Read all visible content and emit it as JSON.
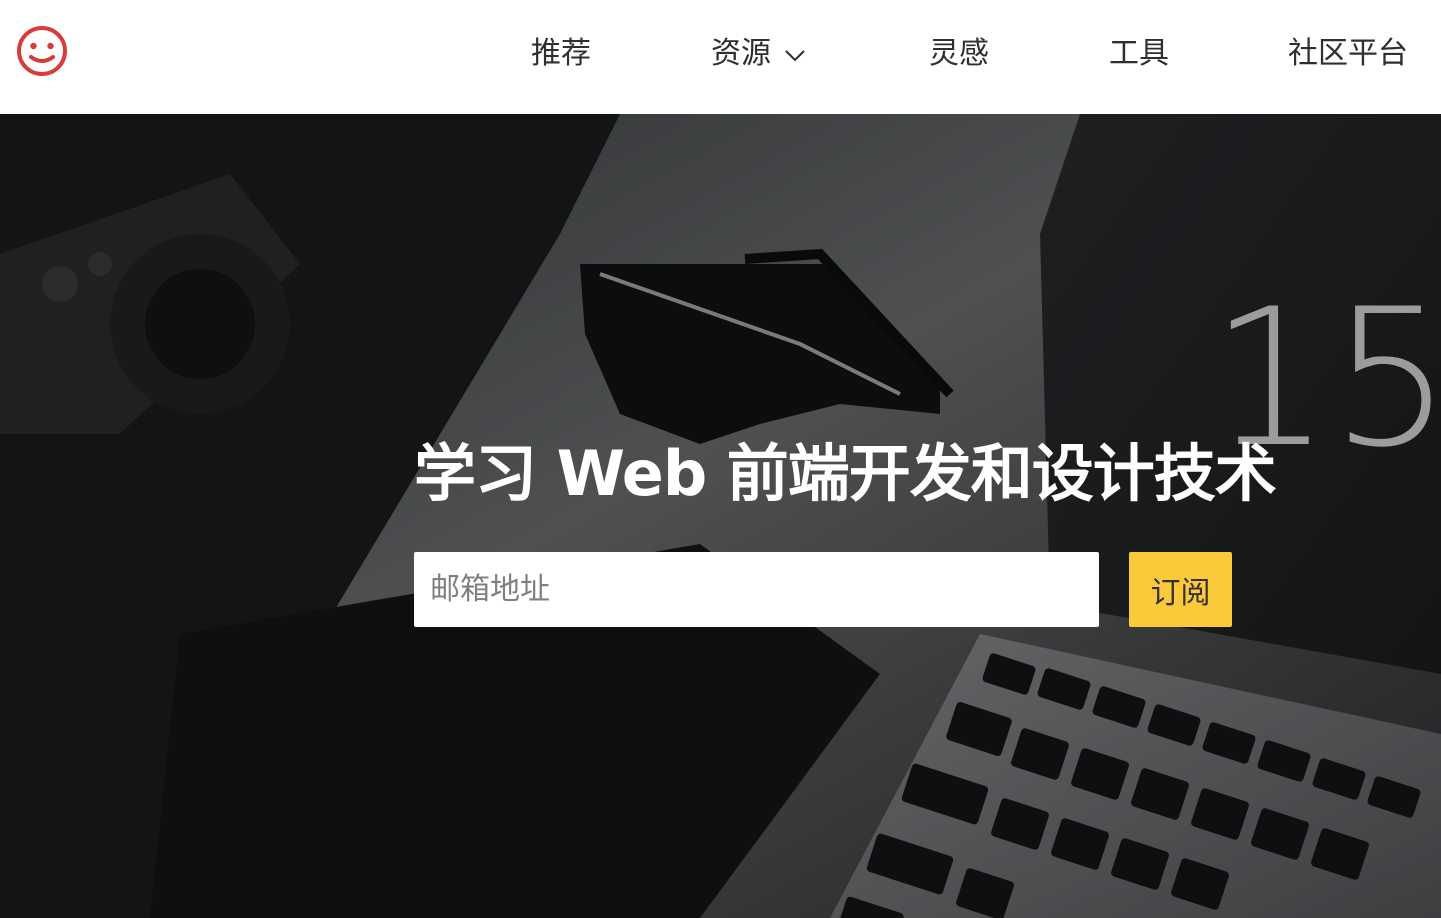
{
  "header": {
    "logo_icon": "smiley-face-icon",
    "logo_color": "#d93a3a",
    "nav": [
      {
        "label": "推荐"
      },
      {
        "label": "资源",
        "icon": "chevron-down-icon"
      },
      {
        "label": "灵感"
      },
      {
        "label": "工具"
      },
      {
        "label": "社区平台"
      }
    ]
  },
  "hero": {
    "title": "学习 Web 前端开发和设计技术",
    "email_placeholder": "邮箱地址",
    "subscribe_label": "订阅",
    "subscribe_color": "#fcc93b",
    "background_photo_text": "15"
  }
}
